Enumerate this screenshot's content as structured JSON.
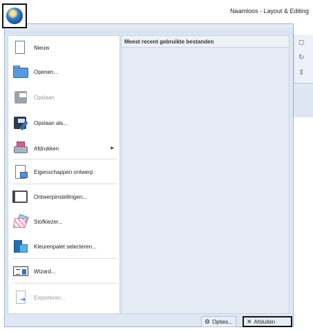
{
  "window": {
    "title": "Naamloos - Layout & Editing"
  },
  "menu": {
    "recent_header": "Meest recent gebruikte bestanden",
    "items": [
      {
        "label": "Nieuw",
        "icon": "new-document-icon",
        "enabled": true
      },
      {
        "label": "Openen...",
        "icon": "open-folder-icon",
        "enabled": true
      },
      {
        "label": "Opslaan",
        "icon": "save-disk-icon",
        "enabled": false
      },
      {
        "label": "Opslaan als...",
        "icon": "save-as-icon",
        "enabled": true
      },
      {
        "label": "Afdrukken",
        "icon": "printer-icon",
        "enabled": true,
        "submenu": true
      },
      {
        "label": "Eigenschappen ontwerp",
        "icon": "design-properties-icon",
        "enabled": true
      },
      {
        "label": "Ontwerpinstellingen...",
        "icon": "design-settings-icon",
        "enabled": true
      },
      {
        "label": "Stofkiezer...",
        "icon": "fabric-selector-icon",
        "enabled": true
      },
      {
        "label": "Kleurenpalet selecteren...",
        "icon": "color-palette-icon",
        "enabled": true
      },
      {
        "label": "Wizard...",
        "icon": "wizard-icon",
        "enabled": true
      },
      {
        "label": "Exporteren...",
        "icon": "export-icon",
        "enabled": false
      }
    ]
  },
  "footer": {
    "options_label": "Opties...",
    "exit_label": "Afsluiten"
  }
}
